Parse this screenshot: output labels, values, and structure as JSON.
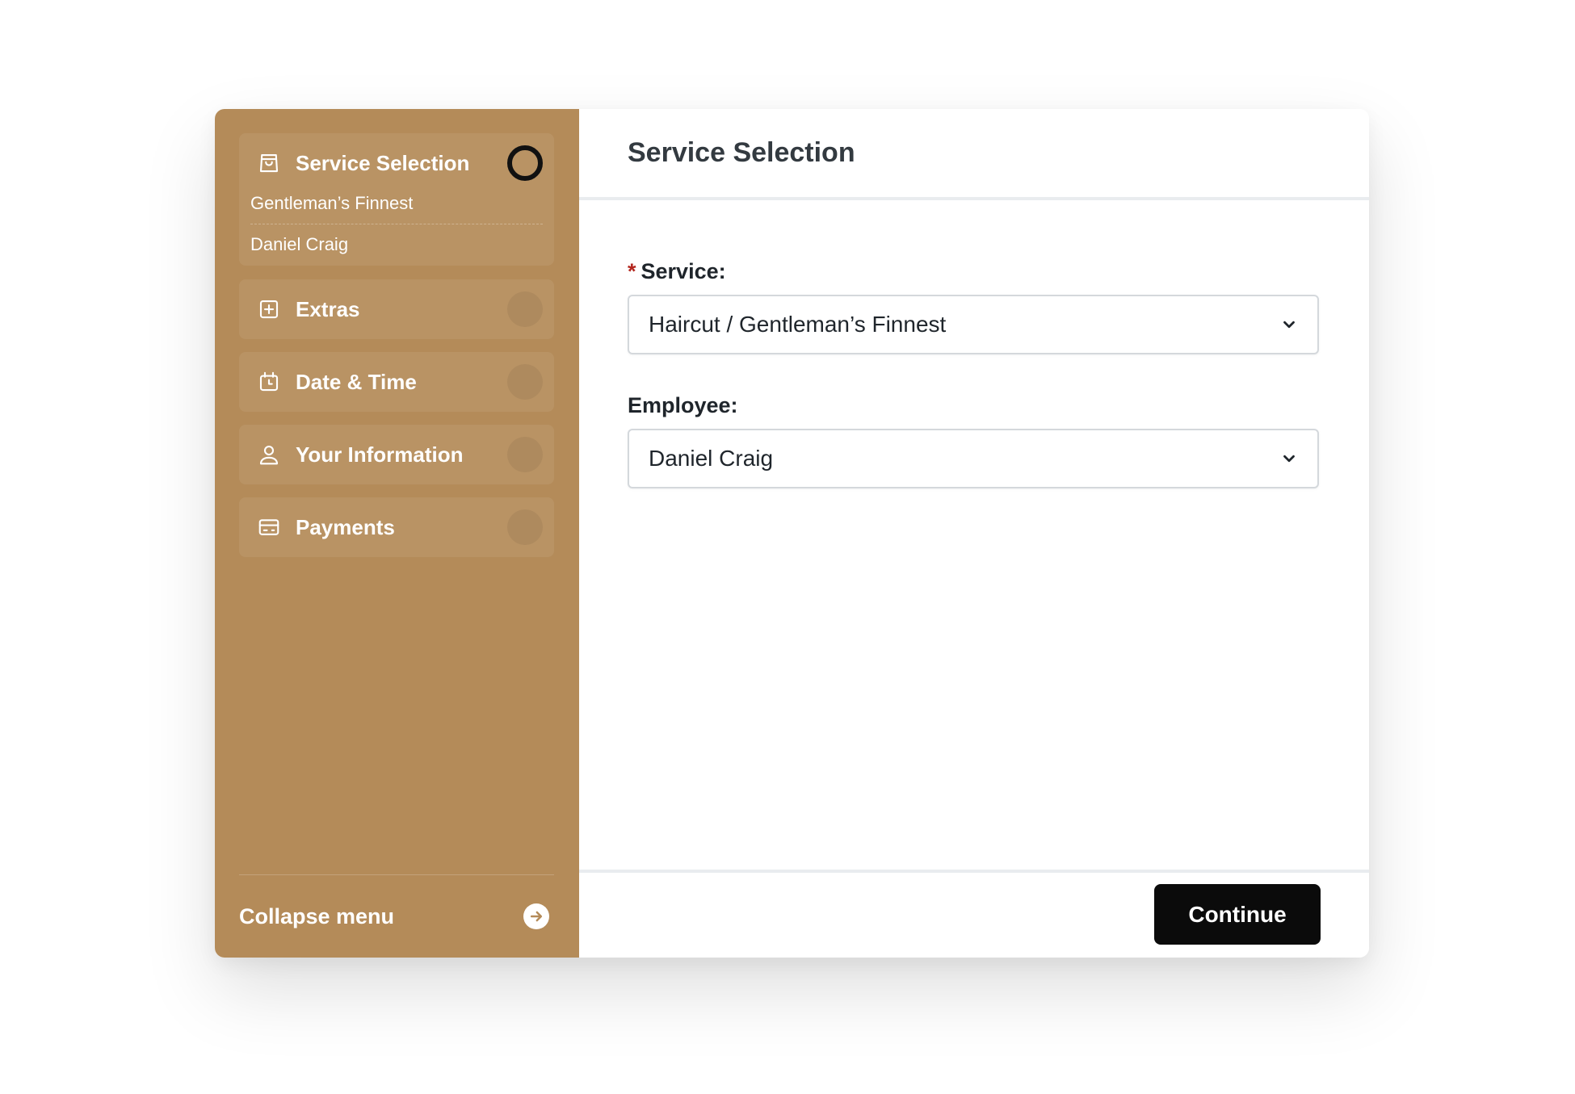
{
  "sidebar": {
    "steps": [
      {
        "label": "Service Selection",
        "icon": "shopping-bag-icon",
        "active": true,
        "details": [
          "Gentleman’s Finnest",
          "Daniel Craig"
        ]
      },
      {
        "label": "Extras",
        "icon": "plus-square-icon",
        "active": false
      },
      {
        "label": "Date & Time",
        "icon": "calendar-clock-icon",
        "active": false
      },
      {
        "label": "Your Information",
        "icon": "user-icon",
        "active": false
      },
      {
        "label": "Payments",
        "icon": "credit-card-icon",
        "active": false
      }
    ],
    "collapse_label": "Collapse menu",
    "collapse_icon": "arrow-right-circle-icon"
  },
  "main": {
    "title": "Service Selection",
    "fields": {
      "service": {
        "label": "Service:",
        "required_marker": "*",
        "value": "Haircut / Gentleman’s Finnest"
      },
      "employee": {
        "label": "Employee:",
        "value": "Daniel Craig"
      }
    },
    "continue_label": "Continue"
  },
  "colors": {
    "sidebar_bg": "#b48b59",
    "button_bg": "#0b0b0b",
    "required": "#b3261e"
  }
}
